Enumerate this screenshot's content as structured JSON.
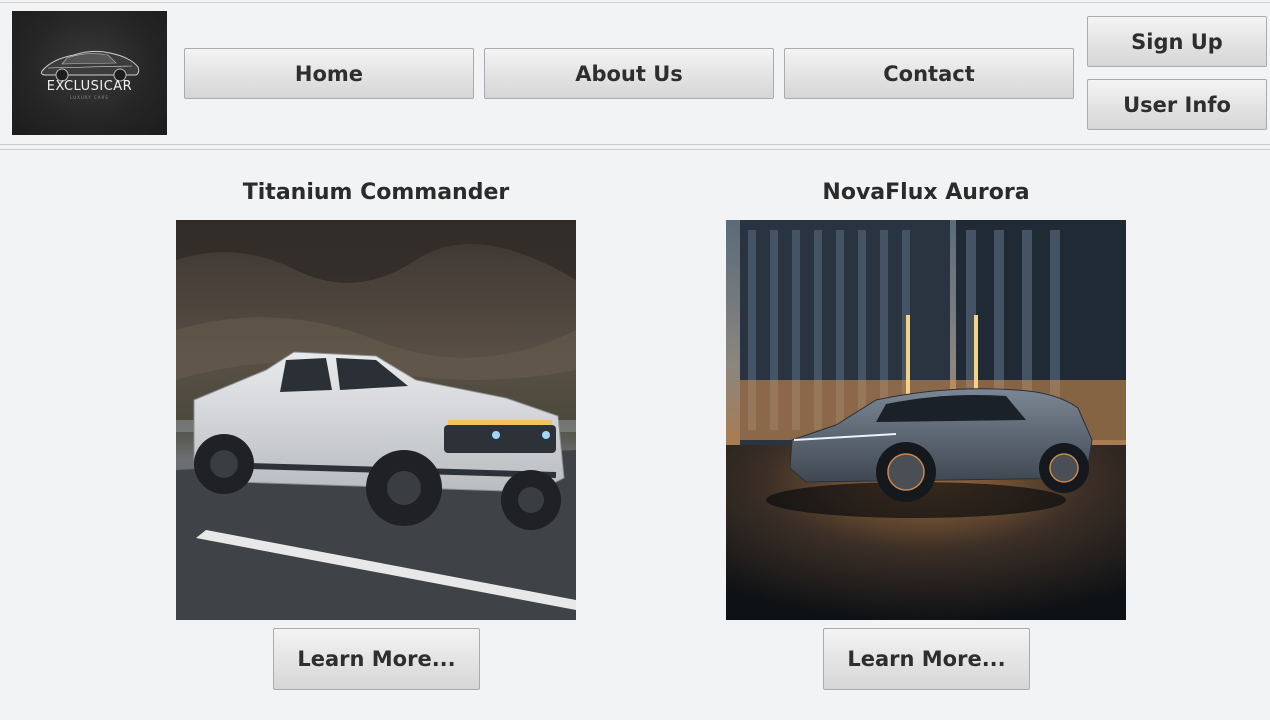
{
  "brand": {
    "name": "EXCLUSICAR",
    "tagline": "LUXURY CARS"
  },
  "nav": [
    {
      "label": "Home"
    },
    {
      "label": "About Us"
    },
    {
      "label": "Contact"
    }
  ],
  "account": {
    "signup_label": "Sign Up",
    "userinfo_label": "User Info"
  },
  "cars": [
    {
      "name": "Titanium Commander",
      "image": "white-pickup-truck-on-highway",
      "button_label": "Learn More..."
    },
    {
      "name": "NovaFlux Aurora",
      "image": "grey-electric-suv-at-night-building",
      "button_label": "Learn More..."
    }
  ],
  "colors": {
    "background": "#f2f3f5",
    "button_face": "#e3e3e3",
    "text": "#2b2b2b",
    "logo_bg": "#262626"
  }
}
